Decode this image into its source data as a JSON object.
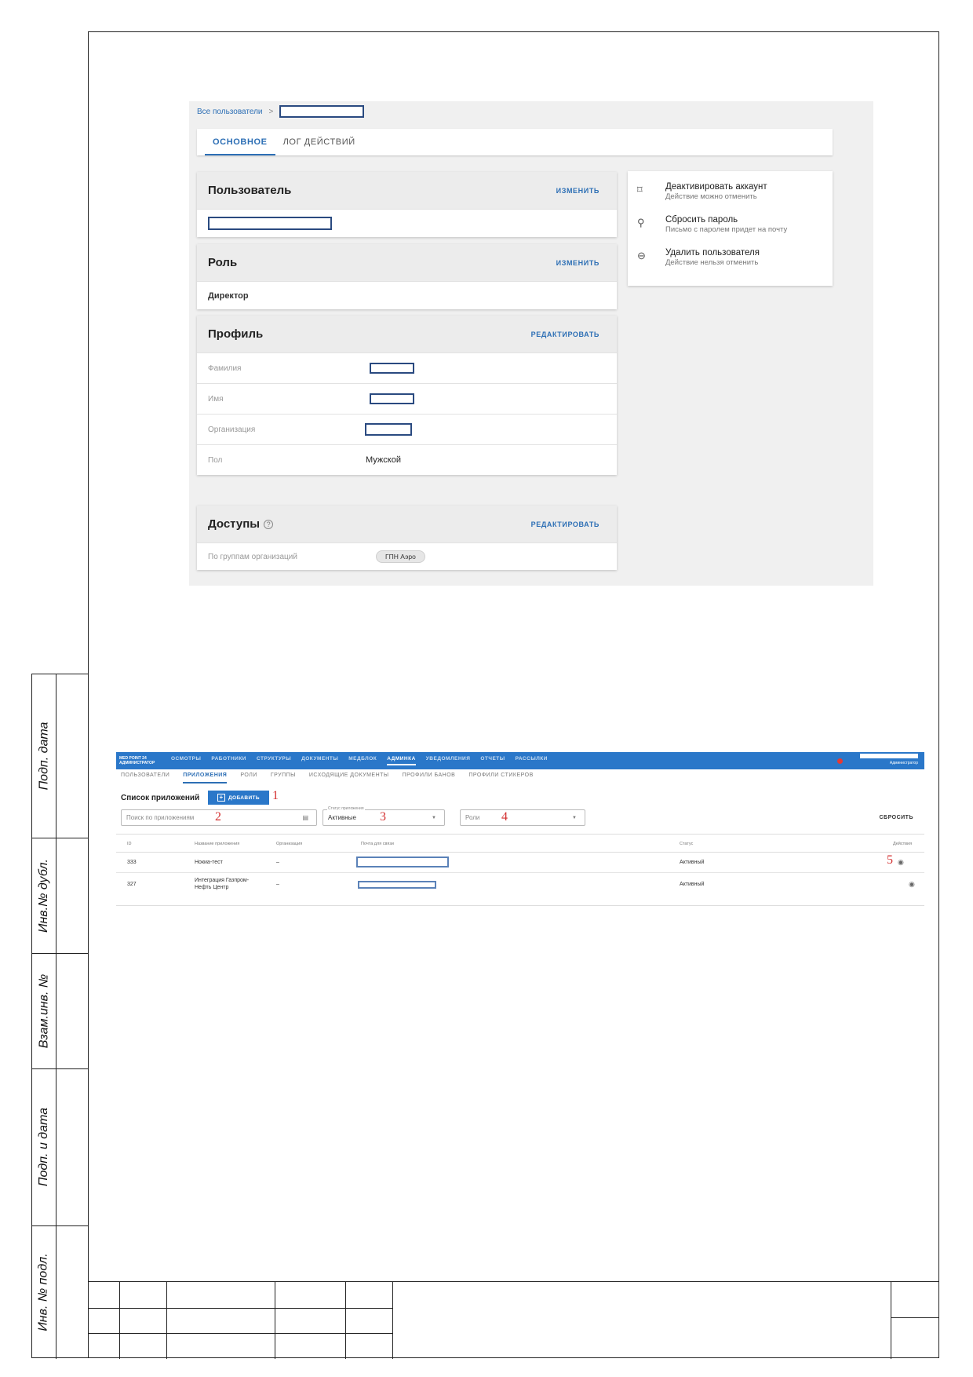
{
  "stamp_side": {
    "labels": [
      "Подп. дата",
      "Инв.№ дубл.",
      "Взам.инв. №",
      "Подп. и дата",
      "Инв. № подл."
    ]
  },
  "user_card_screen": {
    "breadcrumb": {
      "root": "Все пользователи",
      "separator": ">"
    },
    "tabs": [
      {
        "label": "ОСНОВНОЕ",
        "active": true
      },
      {
        "label": "ЛОГ ДЕЙСТВИЙ",
        "active": false
      }
    ],
    "user_section": {
      "title": "Пользователь",
      "action": "ИЗМЕНИТЬ"
    },
    "role_section": {
      "title": "Роль",
      "action": "ИЗМЕНИТЬ",
      "value": "Директор"
    },
    "profile_section": {
      "title": "Профиль",
      "action": "РЕДАКТИРОВАТЬ",
      "fields": [
        {
          "label": "Фамилия",
          "value": ""
        },
        {
          "label": "Имя",
          "value": ""
        },
        {
          "label": "Организация",
          "value": ""
        },
        {
          "label": "Пол",
          "value": "Мужской"
        }
      ]
    },
    "access_section": {
      "title": "Доступы",
      "help": "?",
      "action": "РЕДАКТИРОВАТЬ",
      "row_label": "По группам организаций",
      "chip": "ГПН Аэро"
    },
    "actions": [
      {
        "icon": "thumb-down-icon",
        "glyph": "⌑",
        "title": "Деактивировать аккаунт",
        "subtitle": "Действие можно отменить"
      },
      {
        "icon": "user-key-icon",
        "glyph": "⚲",
        "title": "Сбросить пароль",
        "subtitle": "Письмо с паролем придет на почту"
      },
      {
        "icon": "minus-circle-icon",
        "glyph": "⊖",
        "title": "Удалить пользователя",
        "subtitle": "Действие нельзя отменить"
      }
    ]
  },
  "apps_screen": {
    "logo": {
      "line1": "MED POINT 24",
      "line2": "АДМИНИСТРАТОР"
    },
    "nav": [
      {
        "label": "ОСМОТРЫ",
        "active": false
      },
      {
        "label": "РАБОТНИКИ",
        "active": false
      },
      {
        "label": "СТРУКТУРЫ",
        "active": false
      },
      {
        "label": "ДОКУМЕНТЫ",
        "active": false
      },
      {
        "label": "МЕДБЛОК",
        "active": false
      },
      {
        "label": "АДМИНКА",
        "active": true
      },
      {
        "label": "УВЕДОМЛЕНИЯ",
        "active": false
      },
      {
        "label": "ОТЧЕТЫ",
        "active": false
      },
      {
        "label": "РАССЫЛКИ",
        "active": false
      }
    ],
    "user_role": "Администратор",
    "subnav": [
      {
        "label": "ПОЛЬЗОВАТЕЛИ",
        "active": false
      },
      {
        "label": "ПРИЛОЖЕНИЯ",
        "active": true
      },
      {
        "label": "РОЛИ",
        "active": false
      },
      {
        "label": "ГРУППЫ",
        "active": false
      },
      {
        "label": "ИСХОДЯЩИЕ ДОКУМЕНТЫ",
        "active": false
      },
      {
        "label": "ПРОФИЛИ БАНОВ",
        "active": false
      },
      {
        "label": "ПРОФИЛИ СТИКЕРОВ",
        "active": false
      }
    ],
    "title": "Список приложений",
    "add_button": "ДОБАВИТЬ",
    "search_placeholder": "Поиск по приложениям",
    "status_filter": {
      "label": "Статус приложения",
      "value": "Активные"
    },
    "roles_placeholder": "Роли",
    "reset": "СБРОСИТЬ",
    "markers": [
      "1",
      "2",
      "3",
      "4",
      "5"
    ],
    "columns": [
      "ID",
      "Название приложения",
      "Организация",
      "Почта для связи",
      "Статус",
      "Действия"
    ],
    "rows": [
      {
        "id": "333",
        "name": "Нокиа-тест",
        "org": "–",
        "email": "",
        "status": "Активный"
      },
      {
        "id": "327",
        "name": "Интеграция Газпром-Нефть Центр",
        "org": "–",
        "email": "",
        "status": "Активный"
      }
    ]
  }
}
